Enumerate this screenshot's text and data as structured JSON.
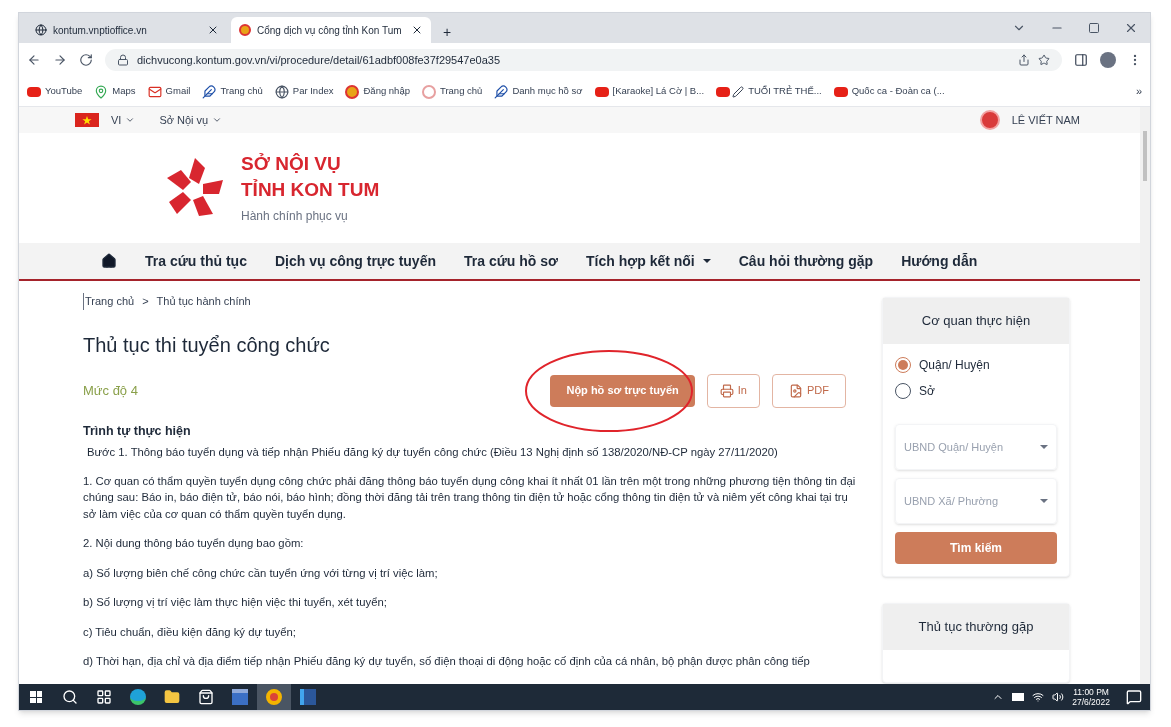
{
  "browser": {
    "tabs": [
      {
        "title": "kontum.vnptioffice.vn",
        "selected": false
      },
      {
        "title": "Cổng dịch vụ công tỉnh Kon Tum",
        "selected": true
      }
    ],
    "new_tab": "+",
    "url": "dichvucong.kontum.gov.vn/vi/procedure/detail/61adbf008fe37f29547e0a35",
    "bookmarks": [
      {
        "label": "YouTube",
        "kind": "youtube"
      },
      {
        "label": "Maps",
        "kind": "maps"
      },
      {
        "label": "Gmail",
        "kind": "gmail"
      },
      {
        "label": "Trang chủ",
        "kind": "feather"
      },
      {
        "label": "Par Index",
        "kind": "globe"
      },
      {
        "label": "Đăng nhập",
        "kind": "emblem"
      },
      {
        "label": "Trang chủ",
        "kind": "ring"
      },
      {
        "label": "Danh mục hồ sơ",
        "kind": "feather"
      },
      {
        "label": "[Karaoke] Lá Cờ | B...",
        "kind": "youtube"
      },
      {
        "label": "TUỔI TRẺ THẾ...",
        "kind": "youtubepen"
      },
      {
        "label": "Quốc ca - Đoàn ca (...",
        "kind": "youtube"
      }
    ],
    "more": "»"
  },
  "topbar": {
    "language": "VI",
    "department": "Sở Nội vụ",
    "user": "LÊ VIẾT NAM"
  },
  "header": {
    "line1": "SỞ NỘI VỤ",
    "line2": "TỈNH KON TUM",
    "tagline": "Hành chính phục vụ"
  },
  "nav": [
    {
      "label": "Tra cứu thủ tục",
      "dropdown": false
    },
    {
      "label": "Dịch vụ công trực tuyến",
      "dropdown": false
    },
    {
      "label": "Tra cứu hồ sơ",
      "dropdown": false
    },
    {
      "label": "Tích hợp kết nối",
      "dropdown": true
    },
    {
      "label": "Câu hỏi thường gặp",
      "dropdown": false
    },
    {
      "label": "Hướng dẫn",
      "dropdown": false
    }
  ],
  "breadcrumb": [
    "Trang chủ",
    "Thủ tục hành chính"
  ],
  "breadcrumb_separator": ">",
  "title": "Thủ tục thi tuyển công chức",
  "level": "Mức độ 4",
  "actions": {
    "submit": "Nộp hồ sơ trực tuyến",
    "print": "In",
    "pdf": "PDF"
  },
  "section_title": "Trình tự thực hiện",
  "paragraphs": [
    "Bước 1. Thông báo tuyển dụng và tiếp nhận Phiếu đăng ký dự tuyển công chức (Điều 13 Nghị định số 138/2020/NĐ-CP ngày 27/11/2020)",
    "1. Cơ quan có thẩm quyền tuyển dụng công chức phải đăng thông báo tuyển dụng công khai ít nhất 01 lần trên một trong những phương tiện thông tin đại chúng sau: Báo in, báo điện tử, báo nói, báo hình; đồng thời đăng tải trên trang thông tin điện tử hoặc cổng thông tin điện tử và niêm yết công khai tại trụ sở làm việc của cơ quan có thẩm quyền tuyển dụng.",
    "2. Nội dung thông báo tuyển dụng bao gồm:",
    "a) Số lượng biên chế công chức cần tuyển ứng với từng vị trí việc làm;",
    "b) Số lượng vị trí việc làm thực hiện việc thi tuyển, xét tuyển;",
    "c) Tiêu chuẩn, điều kiện đăng ký dự tuyển;",
    "d) Thời hạn, địa chỉ và địa điểm tiếp nhận Phiếu đăng ký dự tuyển, số điện thoại di động hoặc cố định của cá nhân, bộ phận được phân công tiếp"
  ],
  "sidebar": {
    "agency_title": "Cơ quan thực hiện",
    "options": [
      {
        "label": "Quận/ Huyện",
        "selected": true
      },
      {
        "label": "Sở",
        "selected": false
      }
    ],
    "selects": [
      {
        "placeholder": "UBND Quận/ Huyện"
      },
      {
        "placeholder": "UBND Xã/ Phường"
      }
    ],
    "search": "Tìm kiếm",
    "common_title": "Thủ tục thường gặp"
  },
  "taskbar": {
    "apps": [
      {
        "kind": "search",
        "active": false
      },
      {
        "kind": "taskview",
        "active": false
      },
      {
        "kind": "edge",
        "active": false
      },
      {
        "kind": "folder",
        "active": false
      },
      {
        "kind": "store",
        "active": false
      },
      {
        "kind": "dev",
        "active": false
      },
      {
        "kind": "chrome",
        "active": true
      },
      {
        "kind": "word",
        "active": false
      }
    ],
    "time": "11:00 PM",
    "date": "27/6/2022"
  }
}
